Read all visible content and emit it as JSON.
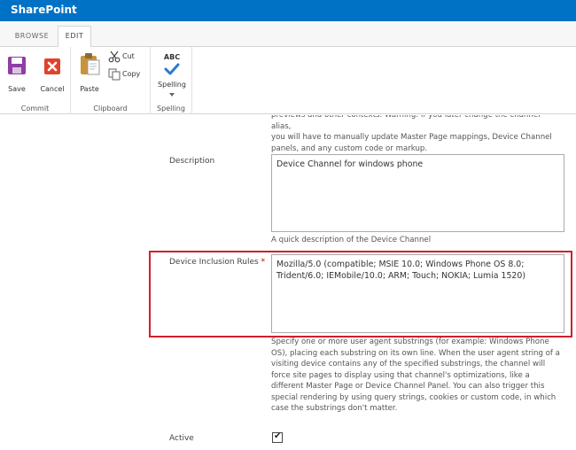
{
  "suitebar": {
    "brand": "SharePoint"
  },
  "tabs": [
    {
      "label": "BROWSE",
      "active": false
    },
    {
      "label": "EDIT",
      "active": true
    }
  ],
  "ribbon": {
    "commit": {
      "group_label": "Commit",
      "save_label": "Save",
      "cancel_label": "Cancel"
    },
    "clipboard": {
      "group_label": "Clipboard",
      "paste_label": "Paste",
      "cut_label": "Cut",
      "copy_label": "Copy"
    },
    "spelling": {
      "group_label": "Spelling",
      "spelling_label": "Spelling",
      "abc_text": "ABC"
    }
  },
  "form": {
    "top_help_lines": [
      "previews and other contexts. Warning: If you later change the channel alias,",
      "you will have to manually update Master Page mappings, Device Channel",
      "panels, and any custom code or markup."
    ],
    "description": {
      "label": "Description",
      "value": "Device Channel for windows phone",
      "help": "A quick description of the Device Channel"
    },
    "inclusion_rules": {
      "label": "Device Inclusion Rules",
      "required_marker": "*",
      "value_lines": [
        "Mozilla/5.0 (compatible; MSIE 10.0; Windows Phone OS 8.0;",
        "Trident/6.0; IEMobile/10.0; ARM; Touch; NOKIA; Lumia 1520)"
      ],
      "help_lines": [
        "Specify one or more user agent substrings (for example: Windows Phone",
        "OS), placing each substring on its own line. When the user agent string of a",
        "visiting device contains any of the specified substrings, the channel will",
        "force site pages to display using that channel's optimizations, like a",
        "different Master Page or Device Channel Panel. You can also trigger this",
        "special rendering by using query strings, cookies or custom code, in which",
        "case the substrings don't matter."
      ]
    },
    "active": {
      "label": "Active",
      "checked": true,
      "check_glyph": "✔"
    }
  },
  "colors": {
    "suitebar": "#0072c6",
    "highlight": "#d0202a",
    "save_icon": "#8e3ea5",
    "cancel_icon": "#e0422c",
    "spelling_check": "#2a7ad0"
  }
}
